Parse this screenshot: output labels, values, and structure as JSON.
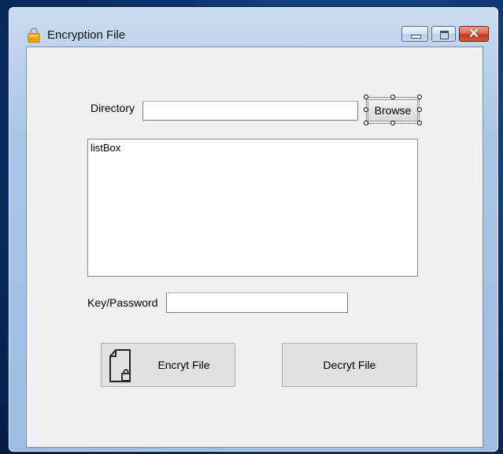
{
  "window": {
    "title": "Encryption File",
    "icon": "lock-icon",
    "controls": {
      "minimize_icon": "minimize-icon",
      "maximize_icon": "maximize-icon",
      "close_icon": "close-icon",
      "close_glyph": "✕"
    }
  },
  "form": {
    "directory_label": "Directory",
    "directory_value": "",
    "browse_label": "Browse",
    "listbox_item": "listBox",
    "key_label": "Key/Password",
    "key_value": "",
    "encrypt_label": "Encryt File",
    "encrypt_icon": "locked-document-icon",
    "decrypt_label": "Decryt File"
  },
  "colors": {
    "client_background": "#f0f0f0",
    "button_background": "#e1e1e1",
    "close_button": "#c23a1c",
    "lock_icon": "#f0a500"
  }
}
